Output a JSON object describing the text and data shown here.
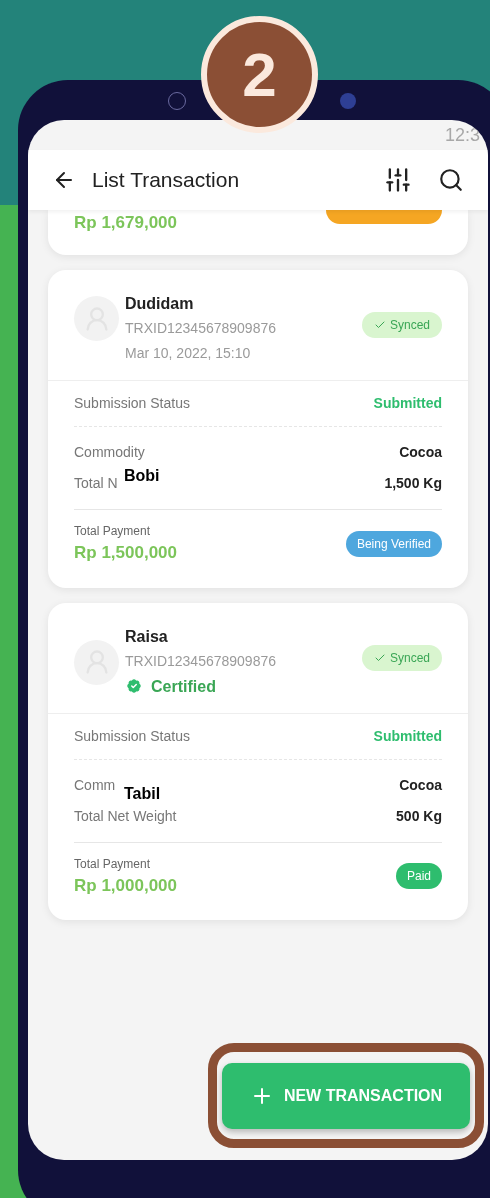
{
  "step_badge": "2",
  "status_bar": {
    "time": "12:3"
  },
  "header": {
    "title": "List Transaction"
  },
  "partial_card": {
    "payment_amount": "Rp 1,679,000",
    "kind": "pending"
  },
  "cards": [
    {
      "name": "Dudidam",
      "transaction_id": "TRXID12345678909876",
      "date": "Mar 10, 2022, 15:10",
      "sync_badge": "Synced",
      "submission": {
        "label": "Submission Status",
        "value": "Submitted"
      },
      "details": [
        {
          "label": "Commodity",
          "value": "Cocoa"
        },
        {
          "label": "Total N",
          "value": "1,500 Kg",
          "annotation": {
            "text": "Bobi",
            "kind": "over"
          }
        }
      ],
      "payment": {
        "label": "Total Payment",
        "amount": "Rp 1,500,000",
        "status": "Being Verified",
        "kind": "verifying"
      }
    },
    {
      "name": "Raisa",
      "transaction_id": "TRXID12345678909876",
      "certification": "Certified",
      "sync_badge": "Synced",
      "submission": {
        "label": "Submission Status",
        "value": "Submitted"
      },
      "details": [
        {
          "label": "Comm",
          "value": "Cocoa",
          "annotation": {
            "text": "Tabil",
            "kind": "below"
          }
        },
        {
          "label": "Total Net Weight",
          "value": "500 Kg"
        }
      ],
      "payment": {
        "label": "Total Payment",
        "amount": "Rp 1,000,000",
        "status": "Paid",
        "kind": "paid"
      }
    }
  ],
  "new_transaction_button": {
    "label": "NEW TRANSACTION",
    "highlighted": true
  }
}
